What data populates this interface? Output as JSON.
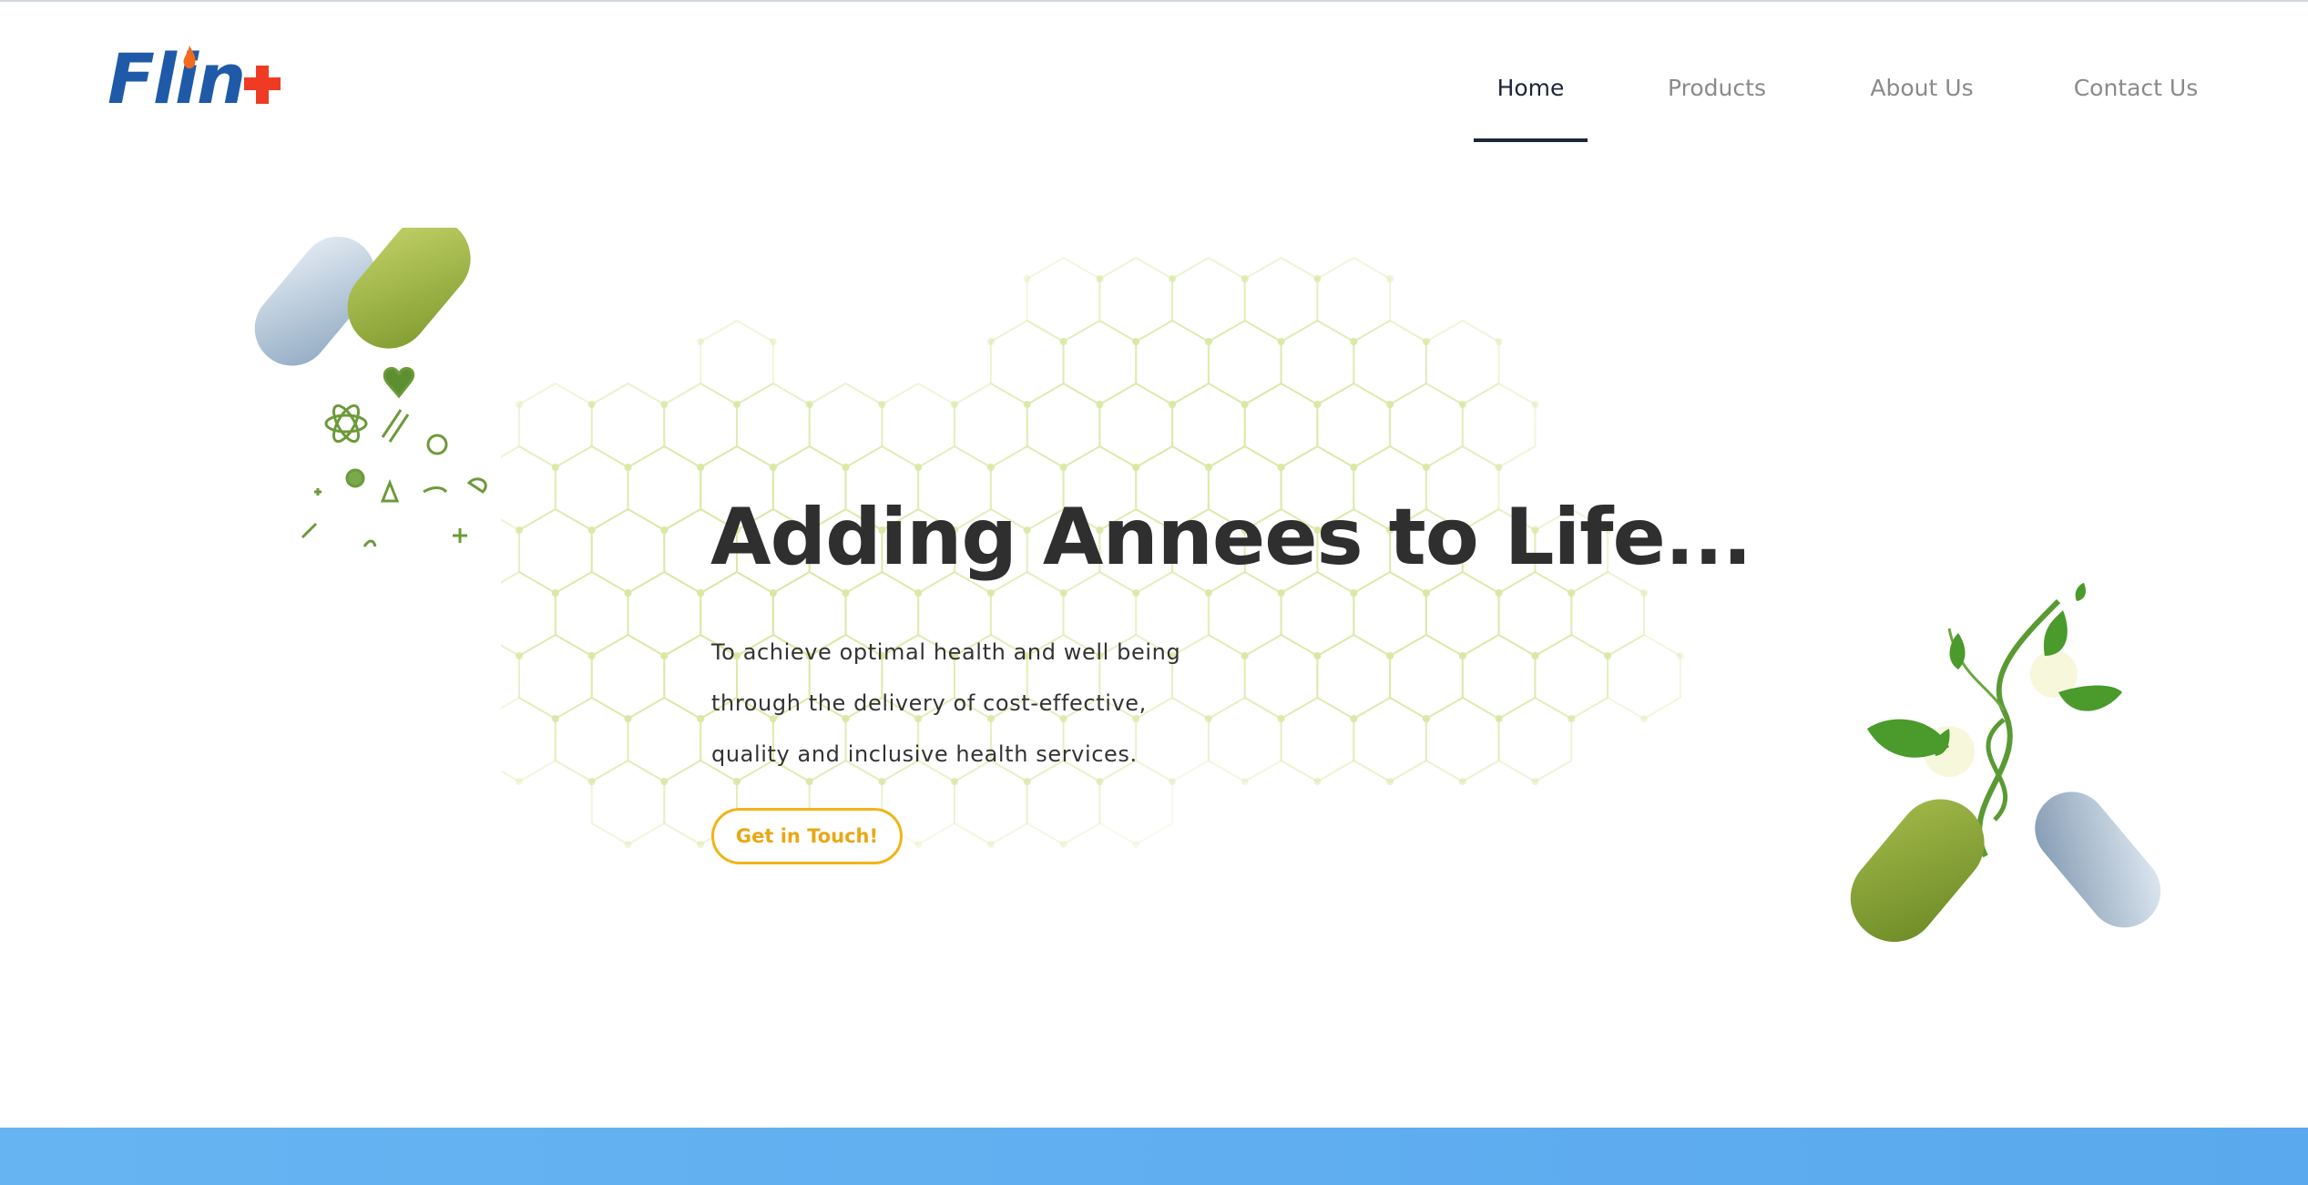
{
  "brand": {
    "logo_text": "Flin",
    "logo_icons": [
      "flame-icon",
      "medical-cross-icon"
    ]
  },
  "nav": {
    "items": [
      {
        "label": "Home",
        "active": true
      },
      {
        "label": "Products",
        "active": false
      },
      {
        "label": "About Us",
        "active": false
      },
      {
        "label": "Contact Us",
        "active": false
      }
    ]
  },
  "hero": {
    "title": "Adding Annees to Life...",
    "description_lines": [
      "To achieve optimal health and well being",
      "through the delivery of cost-effective,",
      "quality and inclusive health services."
    ],
    "cta_label": "Get in Touch!"
  },
  "colors": {
    "accent": "#f2b318",
    "nav_active": "#1c2637",
    "heading": "#2f2f2f",
    "band": "#67b4f2",
    "capsule_green": "#8fa93a",
    "capsule_blue": "#a9c0d6",
    "leaf_green": "#4a9a2c"
  }
}
